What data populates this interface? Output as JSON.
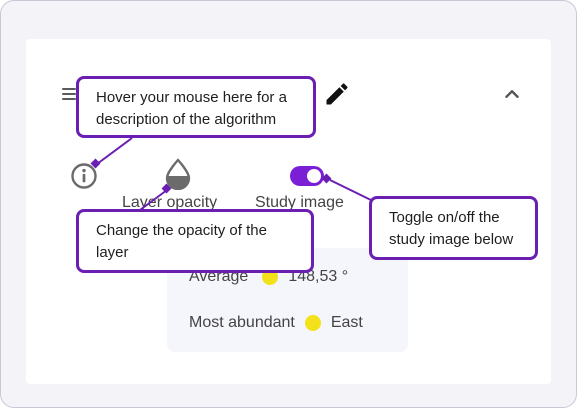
{
  "callouts": {
    "algorithm": "Hover your mouse here for a description of the algorithm",
    "opacity": "Change the opacity of the layer",
    "study_image": "Toggle on/off the study image below"
  },
  "controls": {
    "opacity_label": "Layer opacity",
    "study_image_label": "Study image",
    "study_image_on": true
  },
  "stats": {
    "average_label": "Average",
    "average_value": "148,53 °",
    "most_abundant_label": "Most abundant",
    "most_abundant_value": "East"
  },
  "colors": {
    "accent": "#7a1fd6",
    "callout_border": "#6a1fb2",
    "marker_yellow": "#f3e21a"
  },
  "icons": [
    "drag-handle-icon",
    "edit-pencil-icon",
    "chevron-up-icon",
    "info-icon",
    "opacity-drop-icon"
  ]
}
